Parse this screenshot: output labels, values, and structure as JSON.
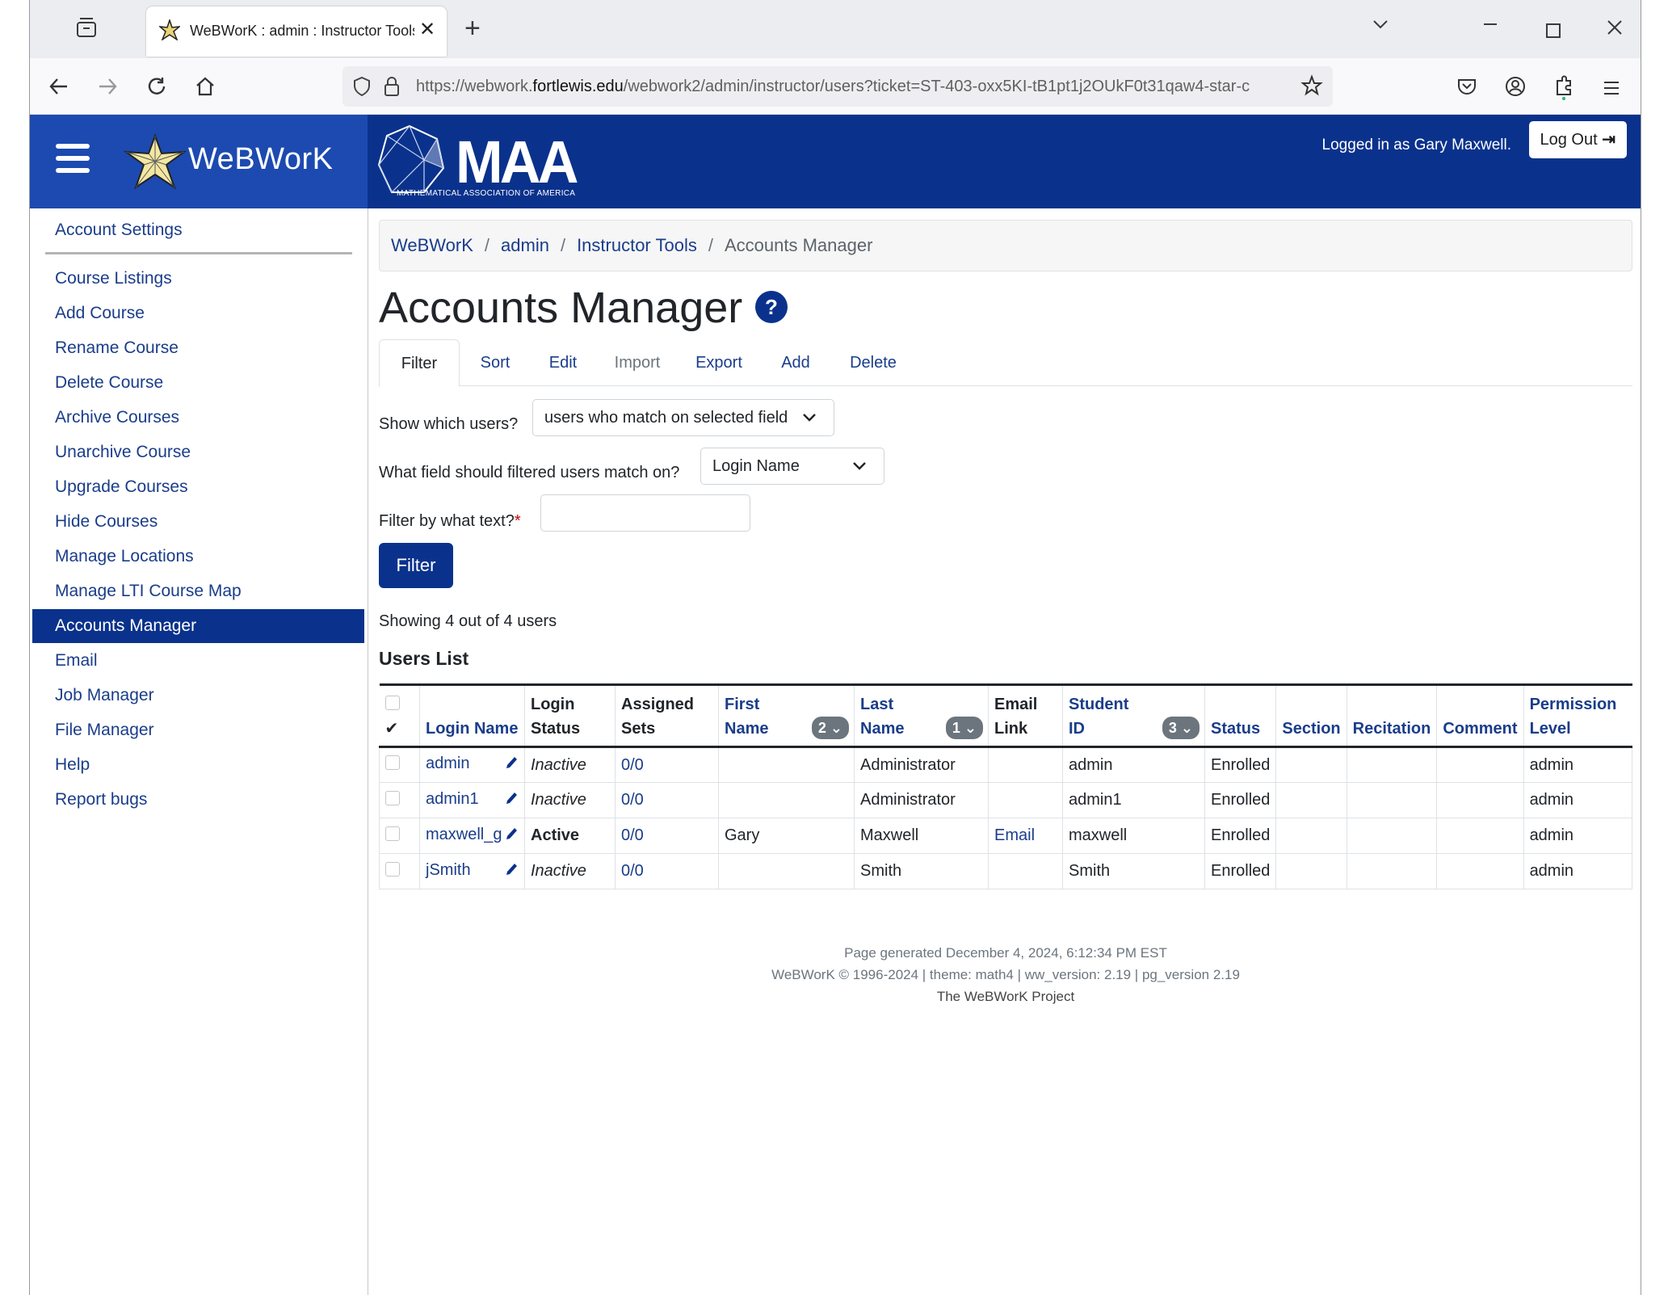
{
  "browser": {
    "tab_title": "WeBWorK : admin : Instructor Tools",
    "url_prefix": "https://webwork.",
    "url_domain": "fortlewis.edu",
    "url_suffix": "/webwork2/admin/instructor/users?ticket=ST-403-oxx5KI-tB1pt1j2OUkF0t31qaw4-star-c"
  },
  "header": {
    "brand": "WeBWorK",
    "maa_name": "MATHEMATICAL ASSOCIATION OF AMERICA",
    "maa_short": "MAA",
    "login_text": "Logged in as Gary Maxwell.",
    "logout_label": "Log Out"
  },
  "sidebar": {
    "items": [
      {
        "label": "Account Settings"
      },
      {
        "label": "Course Listings"
      },
      {
        "label": "Add Course"
      },
      {
        "label": "Rename Course"
      },
      {
        "label": "Delete Course"
      },
      {
        "label": "Archive Courses"
      },
      {
        "label": "Unarchive Course"
      },
      {
        "label": "Upgrade Courses"
      },
      {
        "label": "Hide Courses"
      },
      {
        "label": "Manage Locations"
      },
      {
        "label": "Manage LTI Course Map"
      },
      {
        "label": "Accounts Manager"
      },
      {
        "label": "Email"
      },
      {
        "label": "Job Manager"
      },
      {
        "label": "File Manager"
      },
      {
        "label": "Help"
      },
      {
        "label": "Report bugs"
      }
    ]
  },
  "breadcrumb": [
    "WeBWorK",
    "admin",
    "Instructor Tools",
    "Accounts Manager"
  ],
  "page_title": "Accounts Manager",
  "tabs": [
    "Filter",
    "Sort",
    "Edit",
    "Import",
    "Export",
    "Add",
    "Delete"
  ],
  "filter_form": {
    "show_label": "Show which users?",
    "show_value": "users who match on selected field",
    "field_label": "What field should filtered users match on?",
    "field_value": "Login Name",
    "text_label": "Filter by what text?",
    "required_mark": "*",
    "button_label": "Filter"
  },
  "showing_text": "Showing 4 out of 4 users",
  "users_list_heading": "Users List",
  "table": {
    "headers": {
      "login_name": "Login Name",
      "login_status": [
        "Login",
        "Status"
      ],
      "assigned_sets": [
        "Assigned",
        "Sets"
      ],
      "first_name": [
        "First",
        "Name"
      ],
      "first_name_badge": "2",
      "last_name": [
        "Last",
        "Name"
      ],
      "last_name_badge": "1",
      "email_link": [
        "Email",
        "Link"
      ],
      "student_id": [
        "Student",
        "ID"
      ],
      "student_id_badge": "3",
      "status": "Status",
      "section": "Section",
      "recitation": "Recitation",
      "comment": "Comment",
      "permission": [
        "Permission",
        "Level"
      ]
    },
    "rows": [
      {
        "login": "admin",
        "login_status": "Inactive",
        "sets": "0/0",
        "first": "",
        "last": "Administrator",
        "email": "",
        "sid": "admin",
        "status": "Enrolled",
        "section": "",
        "recitation": "",
        "comment": "",
        "permission": "admin"
      },
      {
        "login": "admin1",
        "login_status": "Inactive",
        "sets": "0/0",
        "first": "",
        "last": "Administrator",
        "email": "",
        "sid": "admin1",
        "status": "Enrolled",
        "section": "",
        "recitation": "",
        "comment": "",
        "permission": "admin"
      },
      {
        "login": "maxwell_g",
        "login_status": "Active",
        "sets": "0/0",
        "first": "Gary",
        "last": "Maxwell",
        "email": "Email",
        "sid": "maxwell",
        "status": "Enrolled",
        "section": "",
        "recitation": "",
        "comment": "",
        "permission": "admin"
      },
      {
        "login": "jSmith",
        "login_status": "Inactive",
        "sets": "0/0",
        "first": "",
        "last": "Smith",
        "email": "",
        "sid": "Smith",
        "status": "Enrolled",
        "section": "",
        "recitation": "",
        "comment": "",
        "permission": "admin"
      }
    ]
  },
  "footer": {
    "generated": "Page generated December 4, 2024, 6:12:34 PM EST",
    "version": "WeBWorK © 1996-2024 | theme: math4 | ww_version: 2.19 | pg_version 2.19",
    "project": "The WeBWorK Project"
  },
  "colors": {
    "brand_blue": "#0a328c",
    "sidebar_header_blue": "#1c4ab0",
    "link": "#1a3d8a"
  }
}
